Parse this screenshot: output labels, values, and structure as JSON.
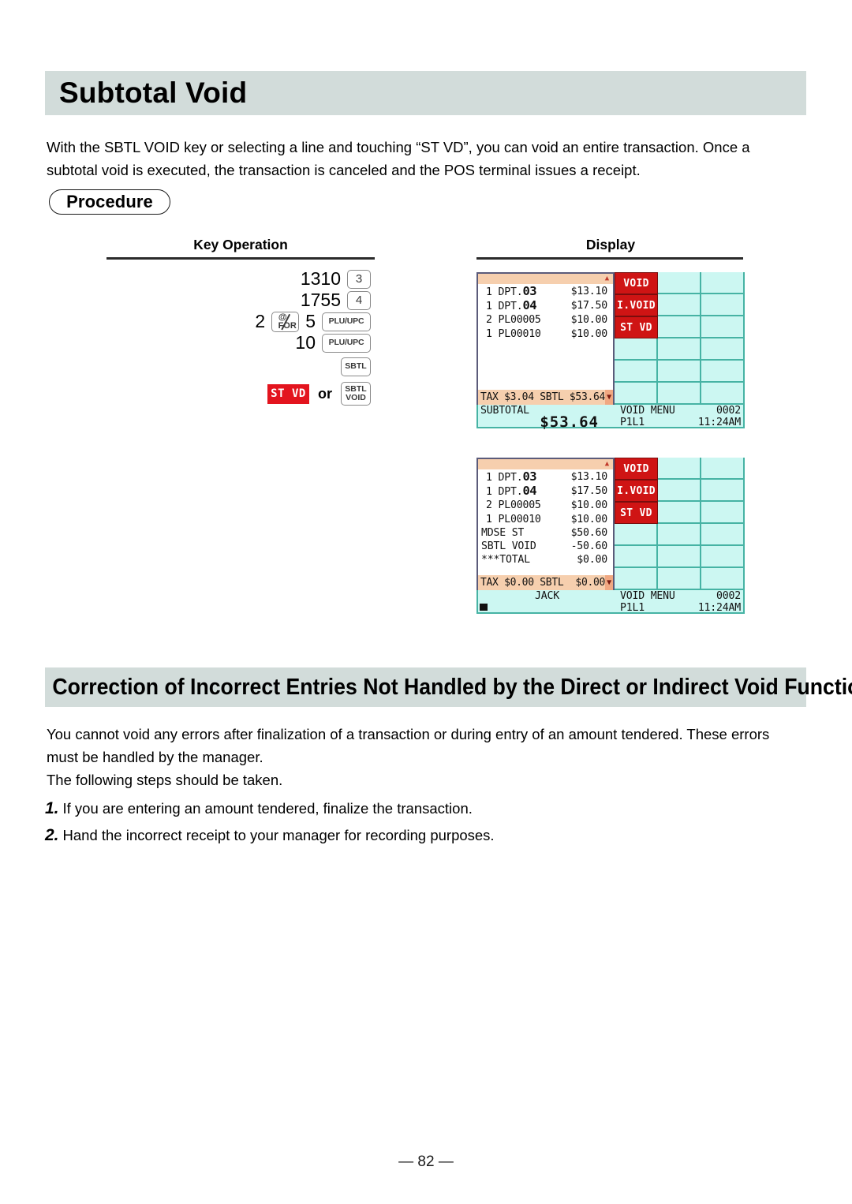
{
  "document": {
    "main_title": "Subtotal Void",
    "intro_paragraph": "With the SBTL VOID key or selecting a line and touching “ST VD”, you can void an entire transaction. Once a subtotal void is executed, the transaction is canceled and the POS terminal issues a receipt.",
    "procedure_label": "Procedure",
    "page_number": "— 82 —"
  },
  "columns": {
    "key_operation_header": "Key Operation",
    "display_header": "Display"
  },
  "key_operation": {
    "rows": [
      {
        "number": "1310",
        "key": "3",
        "key_type": "small"
      },
      {
        "number": "1755",
        "key": "4",
        "key_type": "small"
      },
      {
        "number": "5",
        "key": "PLU/UPC",
        "key_type": "plu",
        "prefix_number": "2",
        "prefix_key": "@/FOR"
      },
      {
        "number": "10",
        "key": "PLU/UPC",
        "key_type": "plu"
      },
      {
        "number": "",
        "key": "SBTL",
        "key_type": "sbtl"
      }
    ],
    "final": {
      "red_key_label": "ST VD",
      "or_label": "or",
      "alt_key_line1": "SBTL",
      "alt_key_line2": "VOID"
    },
    "for_key": {
      "at": "@",
      "for": "FOR"
    }
  },
  "displays": [
    {
      "id": "display-subtotal",
      "scroll_up_icon": "▲",
      "scroll_down_icon": "▼",
      "receipt_lines": [
        {
          "qty": "1",
          "item": "DPT.",
          "dept": "03",
          "amount": "$13.10",
          "big_dept": true
        },
        {
          "qty": "1",
          "item": "DPT.",
          "dept": "04",
          "amount": "$17.50",
          "big_dept": true
        },
        {
          "qty": "2",
          "item": "PL00005",
          "dept": "",
          "amount": "$10.00",
          "big_dept": false
        },
        {
          "qty": "1",
          "item": "PL00010",
          "dept": "",
          "amount": "$10.00",
          "big_dept": false
        }
      ],
      "tax_bar_left": "TAX $3.04 SBTL $53.64",
      "menu_buttons": [
        "VOID",
        "I.VOID",
        "ST VD"
      ],
      "status": {
        "line1_left": "SUBTOTAL",
        "line1_mid": "VOID MENU",
        "line1_right": "0002",
        "line2_left": "$53.64",
        "line2_mid": "P1L1",
        "line2_right": "11:24AM"
      }
    },
    {
      "id": "display-subtotal-voided",
      "scroll_up_icon": "▲",
      "scroll_down_icon": "▼",
      "receipt_lines": [
        {
          "qty": "1",
          "item": "DPT.",
          "dept": "03",
          "amount": "$13.10",
          "big_dept": true
        },
        {
          "qty": "1",
          "item": "DPT.",
          "dept": "04",
          "amount": "$17.50",
          "big_dept": true
        },
        {
          "qty": "2",
          "item": "PL00005",
          "dept": "",
          "amount": "$10.00",
          "big_dept": false
        },
        {
          "qty": "1",
          "item": "PL00010",
          "dept": "",
          "amount": "$10.00",
          "big_dept": false
        },
        {
          "qty": "",
          "item": "MDSE ST",
          "dept": "",
          "amount": "$50.60",
          "big_dept": false
        },
        {
          "qty": "",
          "item": "SBTL VOID",
          "dept": "",
          "amount": "-50.60",
          "big_dept": false
        },
        {
          "qty": "",
          "item": "***TOTAL",
          "dept": "",
          "amount": "$0.00",
          "big_dept": false
        }
      ],
      "tax_bar_left": "TAX $0.00 SBTL  $0.00",
      "menu_buttons": [
        "VOID",
        "I.VOID",
        "ST VD"
      ],
      "status": {
        "line1_left": "JACK",
        "line1_mid": "VOID MENU",
        "line1_right": "0002",
        "line2_left": "",
        "line2_mid": "P1L1",
        "line2_right": "11:24AM"
      }
    }
  ],
  "correction_section": {
    "title": "Correction of Incorrect Entries Not Handled by the Direct or Indirect Void Function",
    "paragraph_1": "You cannot void any errors after finalization of a transaction or during entry of an amount tendered. These errors must be handled by the manager.",
    "paragraph_2": "The following steps should be taken.",
    "steps": [
      {
        "num": "1.",
        "text": "If you are entering an amount tendered, finalize the transaction."
      },
      {
        "num": "2.",
        "text": "Hand the incorrect receipt to your manager for recording purposes."
      }
    ]
  },
  "colors": {
    "band": "#d2dcda",
    "red_key": "#e3141e",
    "menu_red": "#cf1414",
    "receipt_strip": "#f6cfae",
    "grid_cell": "#ccf7f2",
    "grid_border": "#46b3a4"
  }
}
